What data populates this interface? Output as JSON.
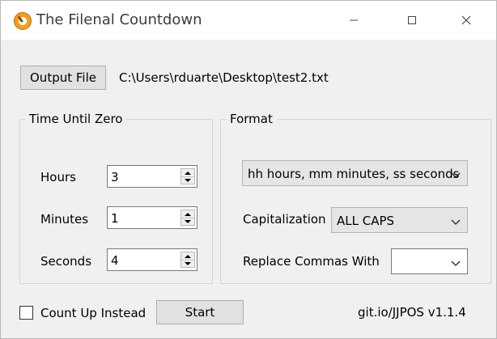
{
  "window": {
    "title": "The Filenal Countdown",
    "controls": {
      "minimize": "minimize",
      "maximize": "maximize",
      "close": "close"
    }
  },
  "output": {
    "button_label": "Output File",
    "path": "C:\\Users\\rduarte\\Desktop\\test2.txt"
  },
  "time_group": {
    "title": "Time Until Zero",
    "hours_label": "Hours",
    "hours_value": "3",
    "minutes_label": "Minutes",
    "minutes_value": "1",
    "seconds_label": "Seconds",
    "seconds_value": "4"
  },
  "format_group": {
    "title": "Format",
    "format_value": "hh hours, mm minutes, ss seconds",
    "capitalization_label": "Capitalization",
    "capitalization_value": "ALL CAPS",
    "replace_label": "Replace Commas With",
    "replace_value": ""
  },
  "footer": {
    "count_up_label": "Count Up Instead",
    "count_up_checked": false,
    "start_label": "Start",
    "version": "git.io/JJPOS v1.1.4"
  },
  "icons": {
    "app": "stopwatch-icon",
    "minimize": "minimize-icon",
    "maximize": "maximize-icon",
    "close": "close-icon",
    "spin_up": "spin-up-icon",
    "spin_down": "spin-down-icon",
    "dropdown": "chevron-down-icon"
  },
  "colors": {
    "window_bg": "#f0f0f0",
    "button_bg": "#e1e1e1",
    "titlebar_bg": "#ffffff"
  }
}
